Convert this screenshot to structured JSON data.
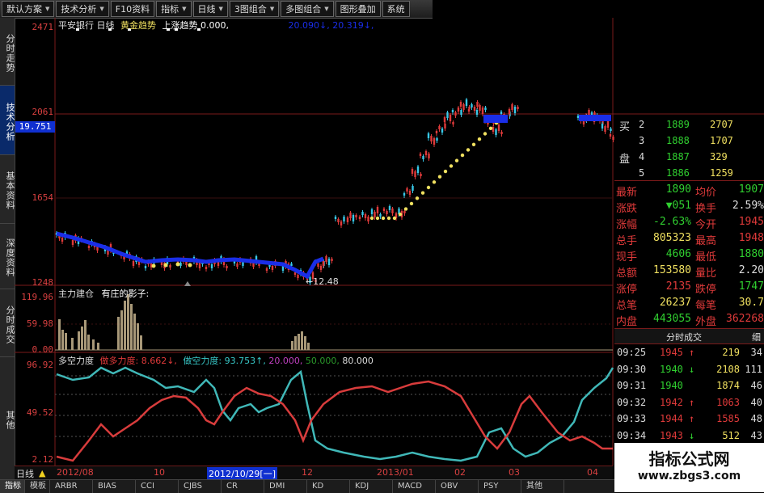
{
  "toolbar": {
    "buttons": [
      {
        "label": "默认方案",
        "dropdown": true
      },
      {
        "label": "技术分析",
        "dropdown": true
      },
      {
        "label": "F10资料",
        "dropdown": false
      },
      {
        "label": "指标",
        "dropdown": true
      },
      {
        "label": "日线",
        "dropdown": true
      },
      {
        "label": "3图组合",
        "dropdown": true
      },
      {
        "label": "多图组合",
        "dropdown": true
      },
      {
        "label": "图形叠加",
        "dropdown": false
      },
      {
        "label": "系统",
        "dropdown": false
      }
    ]
  },
  "left_tabs": [
    {
      "label": "分时走势",
      "active": false
    },
    {
      "label": "技术分析",
      "active": true
    },
    {
      "label": "基本资料",
      "active": false
    },
    {
      "label": "深度资料",
      "active": false
    },
    {
      "label": "分时成交",
      "active": false
    },
    {
      "label": "其他",
      "active": false
    }
  ],
  "price_pane": {
    "stock_name": "平安银行",
    "period": "日线",
    "indicator": "黄金趋势",
    "ind_label": "上涨趋势",
    "ind_val1": "0.000,",
    "ind_val2": "20.090↓, 20.319↓,",
    "y_labels": [
      "2471",
      "2061",
      "1654",
      "1248"
    ],
    "current_price": "19.751",
    "low_mark": "12.48",
    "colors": {
      "up": "#e03a3a",
      "down": "#38c8e8",
      "trend_up": "#f0e060",
      "trend_down": "#1a2ee8"
    }
  },
  "volume_pane": {
    "title": "主力建仓",
    "subtitle": "有庄的影子:",
    "y_labels": [
      "119.96",
      "59.98",
      "0.00"
    ]
  },
  "osc_pane": {
    "title": "多空力度",
    "bull_label": "做多力度:",
    "bull_value": "8.662↓,",
    "bear_label": "做空力度:",
    "bear_value": "93.753↑,",
    "levels": [
      "20.000,",
      "50.000,",
      "80.000"
    ],
    "y_labels": [
      "96.92",
      "49.52",
      "2.12"
    ]
  },
  "orderbook": {
    "buy_label": "买",
    "pan_label": "盘",
    "rows": [
      {
        "level": "2",
        "price": "1889",
        "vol": "2707"
      },
      {
        "level": "3",
        "price": "1888",
        "vol": "1707"
      },
      {
        "level": "4",
        "price": "1887",
        "vol": "329"
      },
      {
        "level": "5",
        "price": "1886",
        "vol": "1259"
      }
    ]
  },
  "quote": [
    {
      "l1": "最新",
      "v1": "1890",
      "l2": "均价",
      "v2": "1907"
    },
    {
      "l1": "涨跌",
      "v1": "▼051",
      "l2": "换手",
      "v2": "2.59%"
    },
    {
      "l1": "涨幅",
      "v1": "-2.63%",
      "l2": "今开",
      "v2": "1945"
    },
    {
      "l1": "总手",
      "v1": "805323",
      "l2": "最高",
      "v2": "1948"
    },
    {
      "l1": "现手",
      "v1": "4606",
      "l2": "最低",
      "v2": "1880"
    },
    {
      "l1": "总额",
      "v1": "153580",
      "l2": "量比",
      "v2": "2.20"
    },
    {
      "l1": "涨停",
      "v1": "2135",
      "l2": "跌停",
      "v2": "1747"
    },
    {
      "l1": "总笔",
      "v1": "26237",
      "l2": "每笔",
      "v2": "30.7"
    },
    {
      "l1": "内盘",
      "v1": "443055",
      "l2": "外盘",
      "v2": "362268"
    }
  ],
  "ticks_header": {
    "title": "分时成交",
    "right": "细"
  },
  "ticks": [
    {
      "time": "09:25",
      "price": "1945",
      "dir": "↑",
      "vol": "219",
      "n": "34"
    },
    {
      "time": "09:30",
      "price": "1940",
      "dir": "↓",
      "vol": "2108",
      "n": "111"
    },
    {
      "time": "09:31",
      "price": "1940",
      "dir": "",
      "vol": "1874",
      "n": "46"
    },
    {
      "time": "09:32",
      "price": "1942",
      "dir": "↑",
      "vol": "1063",
      "n": "40"
    },
    {
      "time": "09:33",
      "price": "1944",
      "dir": "↑",
      "vol": "1585",
      "n": "48"
    },
    {
      "time": "09:34",
      "price": "1943",
      "dir": "↓",
      "vol": "512",
      "n": "43"
    }
  ],
  "date_axis": {
    "period": "日线",
    "labels": [
      "2012/08",
      "10",
      "12",
      "2013/01",
      "02",
      "03",
      "04"
    ],
    "cursor_date": "2012/10/29[一]"
  },
  "bottom_tabs": [
    "指标",
    "模板",
    "ARBR",
    "BIAS",
    "CCI",
    "CJBS",
    "CR",
    "DMI",
    "KD",
    "KDJ",
    "MACD",
    "OBV",
    "PSY",
    "其他"
  ],
  "watermark": {
    "line1": "指标公式网",
    "line2": "www.zbgs3.com"
  }
}
